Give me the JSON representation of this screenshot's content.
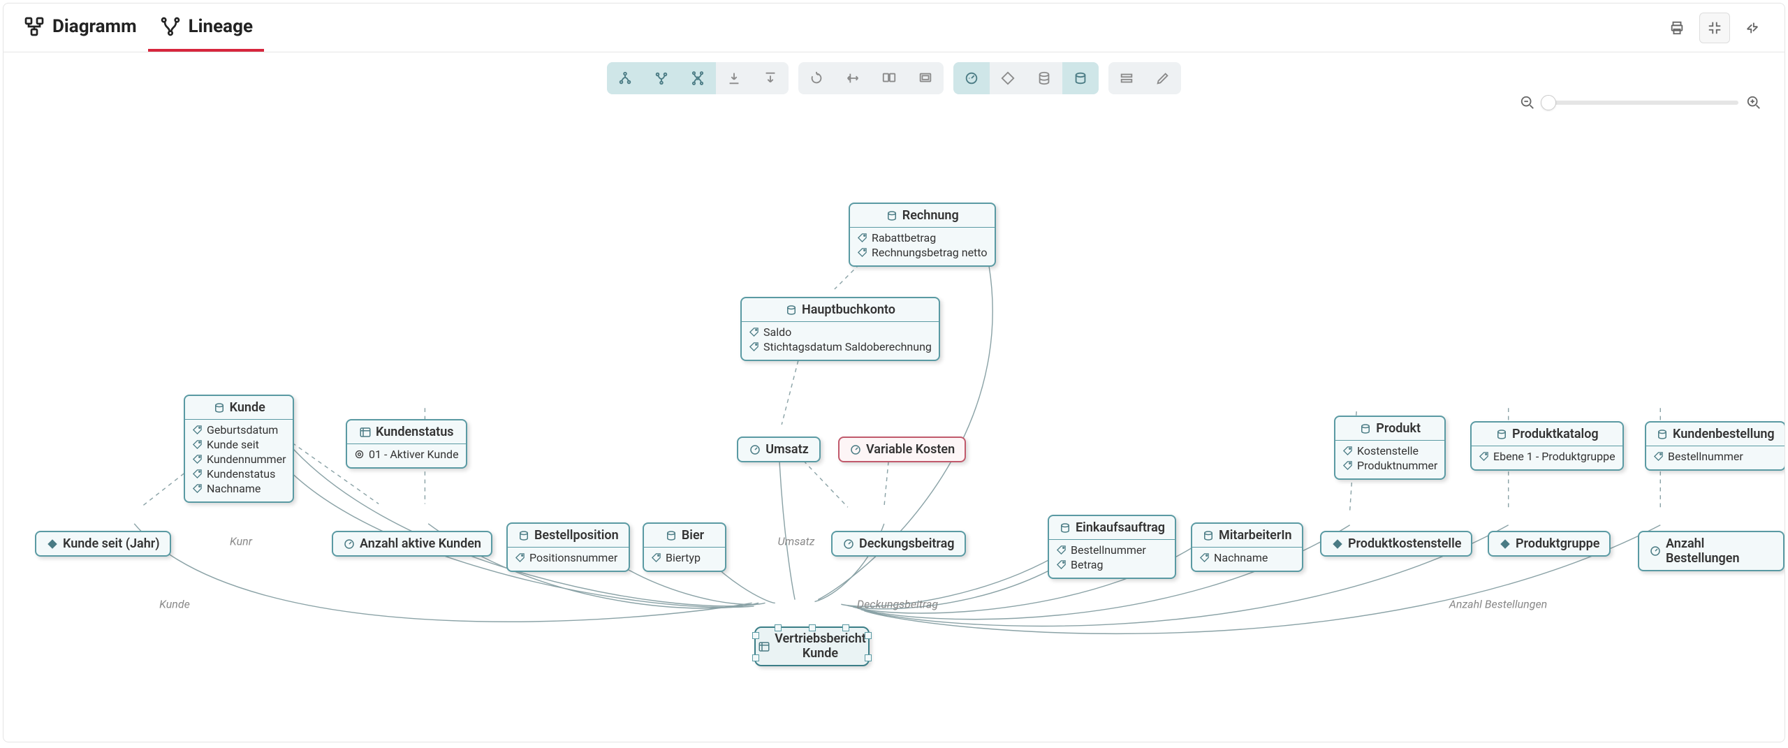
{
  "tabs": {
    "diagram": "Diagramm",
    "lineage": "Lineage"
  },
  "toolbar": {
    "group1": [
      "fork-up",
      "fork-down",
      "fork-both",
      "download",
      "download-top"
    ],
    "group2": [
      "rotate",
      "stretch",
      "screen-split",
      "screen-single"
    ],
    "group3": [
      "metric",
      "diamond",
      "db-stack",
      "entity"
    ],
    "group4": [
      "list-rows",
      "edit-pencil"
    ]
  },
  "nodes": {
    "rechnung": {
      "title": "Rechnung",
      "attrs": [
        "Rabattbetrag",
        "Rechnungsbetrag netto"
      ]
    },
    "hauptbuchkonto": {
      "title": "Hauptbuchkonto",
      "attrs": [
        "Saldo",
        "Stichtagsdatum Saldoberechnung"
      ]
    },
    "kunde": {
      "title": "Kunde",
      "attrs": [
        "Geburtsdatum",
        "Kunde seit",
        "Kundennummer",
        "Kundenstatus",
        "Nachname"
      ]
    },
    "kundenstatus": {
      "title": "Kundenstatus",
      "attrs": [
        "01 - Aktiver Kunde"
      ]
    },
    "umsatz": {
      "title": "Umsatz"
    },
    "variable_kosten": {
      "title": "Variable Kosten"
    },
    "kunde_seit_jahr": {
      "title": "Kunde seit (Jahr)"
    },
    "anzahl_aktive_kunden": {
      "title": "Anzahl aktive Kunden"
    },
    "bestellposition": {
      "title": "Bestellposition",
      "attrs": [
        "Positionsnummer"
      ]
    },
    "bier": {
      "title": "Bier",
      "attrs": [
        "Biertyp"
      ]
    },
    "deckungsbeitrag": {
      "title": "Deckungsbeitrag"
    },
    "einkaufsauftrag": {
      "title": "Einkaufsauftrag",
      "attrs": [
        "Bestellnummer",
        "Betrag"
      ]
    },
    "mitarbeiterin": {
      "title": "MitarbeiterIn",
      "attrs": [
        "Nachname"
      ]
    },
    "produkt": {
      "title": "Produkt",
      "attrs": [
        "Kostenstelle",
        "Produktnummer"
      ]
    },
    "produktkatalog": {
      "title": "Produktkatalog",
      "attrs": [
        "Ebene 1 - Produktgruppe"
      ]
    },
    "kundenbestellung": {
      "title": "Kundenbestellung",
      "attrs": [
        "Bestellnummer"
      ]
    },
    "produktkostenstelle": {
      "title": "Produktkostenstelle"
    },
    "produktgruppe": {
      "title": "Produktgruppe"
    },
    "anzahl_bestellungen": {
      "title": "Anzahl Bestellungen"
    },
    "target": {
      "line1": "Vertriebsbericht",
      "line2": "Kunde"
    }
  },
  "edge_labels": {
    "kunr": "Kunr",
    "kunde": "Kunde",
    "umsatz": "Umsatz",
    "deckungsbeitrag": "Deckungsbeitrag",
    "anzahl_bestellungen": "Anzahl Bestellungen"
  }
}
